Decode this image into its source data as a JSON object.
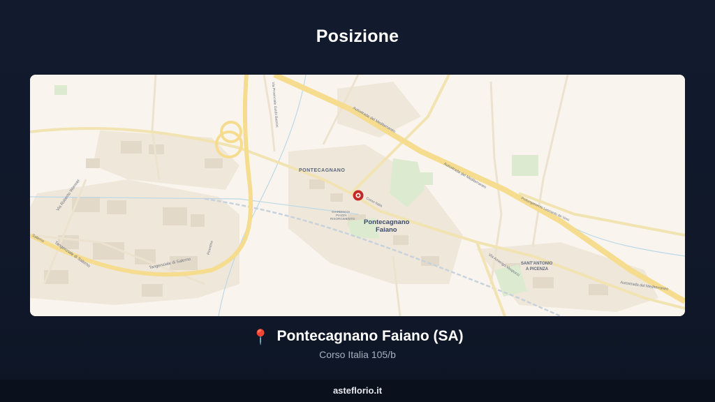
{
  "page": {
    "title": "Posizione"
  },
  "map": {
    "labels": {
      "pontecagnano": "PONTECAGNANO",
      "city_name_1": "Pontecagnano",
      "city_name_2": "Faiano",
      "giardini_1": "GIARDINI DI",
      "giardini_2": "PIAZZA",
      "giardini_3": "RISORGIMENTO",
      "sant_antonio_1": "SANT'ANTONIO",
      "sant_antonio_2": "A PICENZA",
      "corso_italia": "Corso Italia",
      "autostrada_1": "Autostrada del Mediterraneo",
      "autostrada_2": "Autostrada del Mediterraneo",
      "autostrada_3": "Autostrada del Mediterraneo",
      "via_amerigo": "Via Amerigo Vespucci",
      "prolungamento": "Prolungamento Leonardo da Vinci",
      "tangenziale_1": "Tangenziale di Salerno",
      "tangenziale_2": "Tangenziale di Salerno",
      "via_roberto": "Via Roberto Wenner",
      "via_provinciale": "Via Provinciale Guido Bassini",
      "picentino": "Picentino",
      "salerno": "Salerno"
    },
    "marker_icon": "map-pin-icon",
    "colors": {
      "background": "#f9f5ee",
      "road": "#f6e3a1",
      "marker": "#c62828"
    }
  },
  "location": {
    "pin_icon": "📍",
    "city": "Pontecagnano Faiano (SA)",
    "address": "Corso Italia 105/b"
  },
  "footer": {
    "brand": "asteflorio.it"
  }
}
